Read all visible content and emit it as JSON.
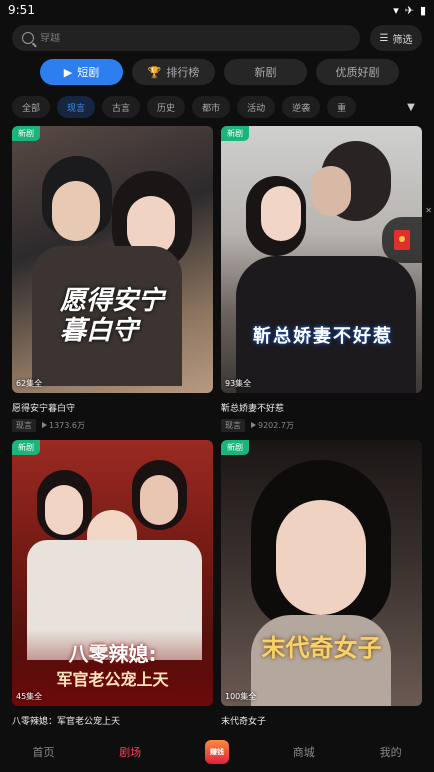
{
  "status": {
    "time": "9:51"
  },
  "search": {
    "placeholder": "穿越",
    "filter_label": "筛选"
  },
  "main_tabs": [
    {
      "label": "短剧",
      "active": true
    },
    {
      "label": "排行榜",
      "active": false
    },
    {
      "label": "新剧",
      "active": false
    },
    {
      "label": "优质好剧",
      "active": false
    }
  ],
  "categories": [
    {
      "label": "全部",
      "active": false
    },
    {
      "label": "现言",
      "active": true
    },
    {
      "label": "古言",
      "active": false
    },
    {
      "label": "历史",
      "active": false
    },
    {
      "label": "都市",
      "active": false
    },
    {
      "label": "活动",
      "active": false
    },
    {
      "label": "逆袭",
      "active": false
    },
    {
      "label": "重",
      "active": false
    }
  ],
  "cards": [
    {
      "badge": "新剧",
      "episodes": "62集全",
      "poster_text": "愿得安宁暮白守",
      "title": "愿得安宁暮白守",
      "genre": "现言",
      "plays": "1373.6万"
    },
    {
      "badge": "新剧",
      "episodes": "93集全",
      "poster_text": "靳总娇妻不好惹",
      "title": "靳总娇妻不好惹",
      "genre": "现言",
      "plays": "9202.7万"
    },
    {
      "badge": "新剧",
      "episodes": "45集全",
      "poster_text_1": "八零辣媳:",
      "poster_text_2": "军官老公宠上天",
      "title": "八零辣媳：军官老公宠上天"
    },
    {
      "badge": "新剧",
      "episodes": "100集全",
      "poster_text": "末代奇女子",
      "title": "末代奇女子"
    }
  ],
  "bottom_nav": {
    "home": "首页",
    "theater": "剧场",
    "earn": "赚钱",
    "mall": "商城",
    "mine": "我的"
  },
  "colors": {
    "accent": "#2d7ff0",
    "new_badge": "#19b57a",
    "active_nav": "#ff3d5a"
  }
}
